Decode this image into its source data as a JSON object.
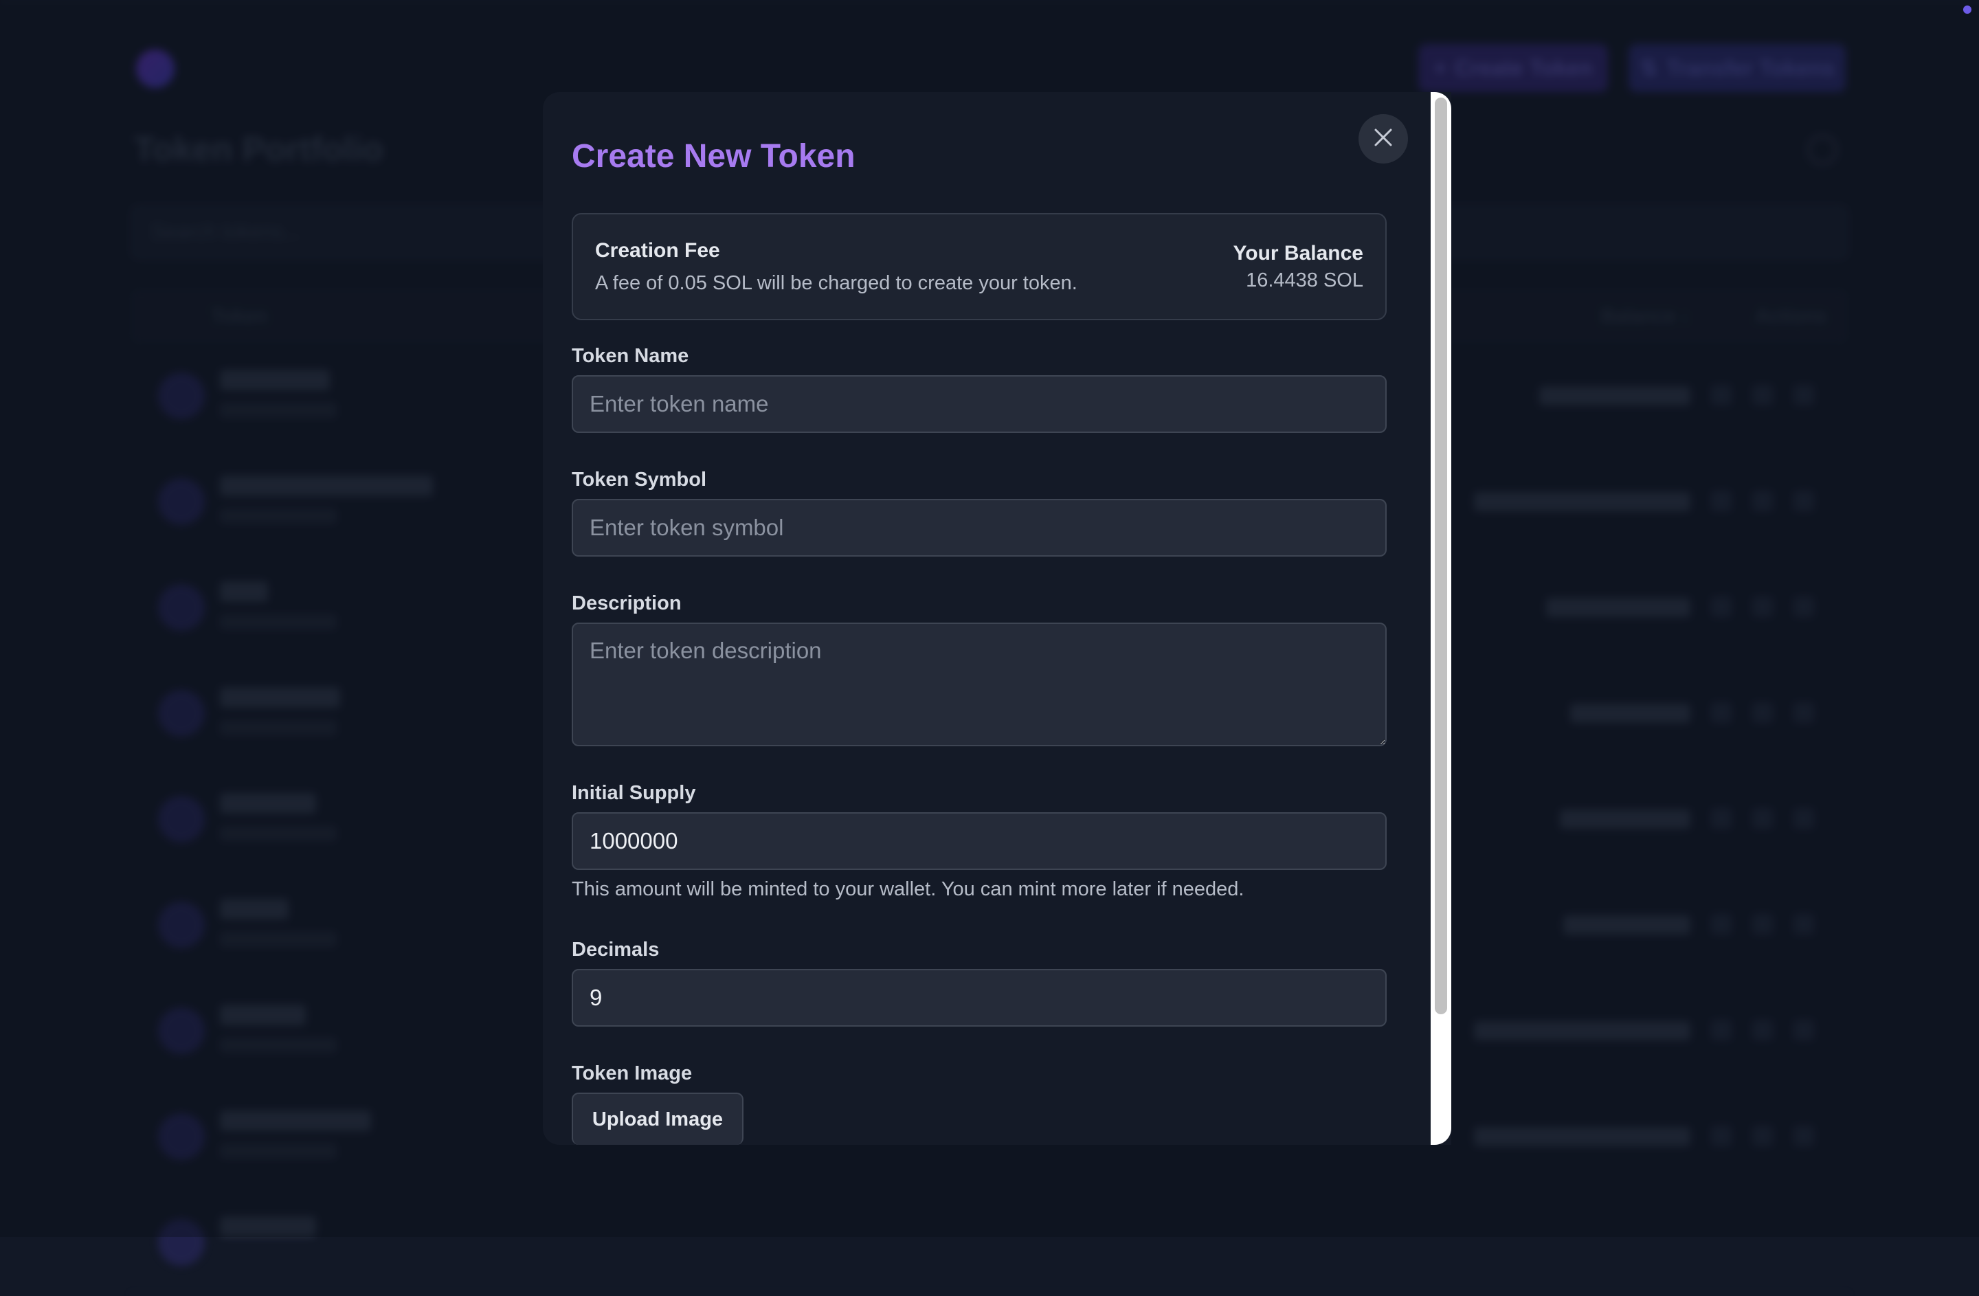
{
  "background": {
    "title": "Token Portfolio",
    "create_token_label": "Create Token",
    "transfer_tokens_label": "Transfer Tokens",
    "search_placeholder": "Search tokens...",
    "columns": {
      "token": "Token",
      "balance": "Balance ↓",
      "actions": "Actions"
    }
  },
  "modal": {
    "title": "Create New Token",
    "close_icon": "close-icon",
    "fee": {
      "title": "Creation Fee",
      "text": "A fee of 0.05 SOL will be charged to create your token.",
      "balance_label": "Your Balance",
      "balance_value": "16.4438 SOL"
    },
    "fields": {
      "name": {
        "label": "Token Name",
        "placeholder": "Enter token name",
        "value": ""
      },
      "symbol": {
        "label": "Token Symbol",
        "placeholder": "Enter token symbol",
        "value": ""
      },
      "description": {
        "label": "Description",
        "placeholder": "Enter token description",
        "value": ""
      },
      "supply": {
        "label": "Initial Supply",
        "value": "1000000",
        "help": "This amount will be minted to your wallet. You can mint more later if needed."
      },
      "decimals": {
        "label": "Decimals",
        "value": "9"
      },
      "image": {
        "label": "Token Image",
        "button": "Upload Image"
      }
    }
  },
  "colors": {
    "accent": "#a77bf0",
    "modal_bg": "#141a27",
    "page_bg": "#121826"
  }
}
